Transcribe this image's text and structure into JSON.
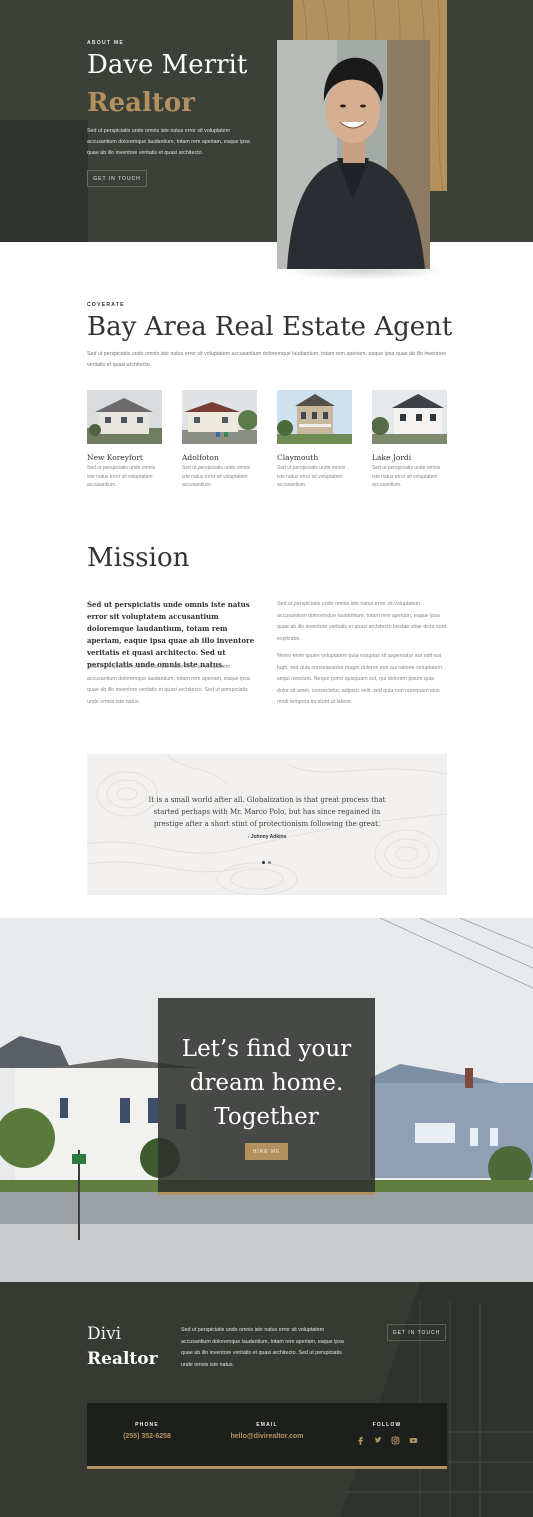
{
  "colors": {
    "dark": "#3b4039",
    "accent": "#b3915f",
    "footer": "#353a33"
  },
  "hero": {
    "eyebrow": "About Me",
    "name": "Dave Merrit",
    "role": "Realtor",
    "description": "Sed ut perspiciatis unde omnis iste natus error sit voluptatem accusantium doloremque laudantium, totam rem aperiam, eaque ipsa quae ab illo inventore veritatis et quasi architecto.",
    "button": "Get in touch"
  },
  "services": {
    "eyebrow": "Coverate",
    "title": "Bay Area Real Estate Agent",
    "description": "Sed ut perspiciatis unde omnis iste natus error sit voluptatem accusantium doloremque laudantium, totam rem aperiam, eaque ipsa quae ab illo inventore veritatis et quasi architecto.",
    "listings": [
      {
        "name": "New Koreyfort",
        "desc": "Sed ut perspiciatis unde omnis iste natus error sit voluptatem accusantium."
      },
      {
        "name": "Adolfoton",
        "desc": "Sed ut perspiciatis unde omnis iste natus error sit voluptatem accusantium."
      },
      {
        "name": "Claymouth",
        "desc": "Sed ut perspiciatis unde omnis iste natus error sit voluptatem accusantium."
      },
      {
        "name": "Lake Jordi",
        "desc": "Sed ut perspiciatis unde omnis iste natus error sit voluptatem accusantium."
      }
    ]
  },
  "mission": {
    "title": "Mission",
    "lead": "Sed ut perspiciatis unde omnis iste natus error sit voluptatem accusantium doloremque laudantium, totam rem aperiam, eaque ipsa quae ab illo inventore veritatis et quasi architecto. Sed ut perspiciatis unde omnis iste natus.",
    "left_small": "Sed ut perspiciatis unde omnis iste natus error sit voluptatem accusantium doloremque laudantium, totam rem aperiam, eaque ipsa quae ab illo inventore veritatis et quasi architecto. Sed ut perspiciatis unde omnis iste natus.",
    "right_p1": "Sed ut perspiciatis unde omnis iste natus error sit voluptatem accusantium doloremque laudantium, totam rem aperiam, eaque ipsa quae ab illo inventore veritatis et quasi architecto beatae vitae dicta sunt explicabo.",
    "right_p2": "Nemo enim ipsam voluptatem quia voluptas sit aspernatur aut odit aut fugit, sed quia consequuntur magni dolores eos qui ratione voluptatem sequi nesciunt. Neque porro quisquam est, qui dolorem ipsum quia dolor sit amet, consectetur, adipisci velit, sed quia non numquam eius modi tempora incidunt ut labore."
  },
  "testimonial": {
    "quote": "It is a small world after all. Globalization is that great process that started perhaps with Mr. Marco Polo, but has since regained its prestige after a short stint of protectionism following the great.",
    "author": "- Johnny Adkins"
  },
  "cta": {
    "heading": "Let’s find your dream home. Together",
    "button": "Hire me"
  },
  "footer": {
    "logo_line1": "Divi",
    "logo_line2": "Realtor",
    "description": "Sed ut perspiciatis unde omnis iste natus error sit voluptatem accusantium doloremque laudantium, totam rem aperiam, eaque ipsa quae ab illo inventore veritatis et quasi architecto. Sed ut perspiciatis unde omnis iste natus.",
    "button": "Get in touch",
    "phone_label": "Phone",
    "phone": "(255) 352-6258",
    "email_label": "Email",
    "email": "hello@divirealtor.com",
    "follow_label": "Follow",
    "social_icons": [
      "facebook-icon",
      "twitter-icon",
      "instagram-icon",
      "youtube-icon"
    ]
  }
}
